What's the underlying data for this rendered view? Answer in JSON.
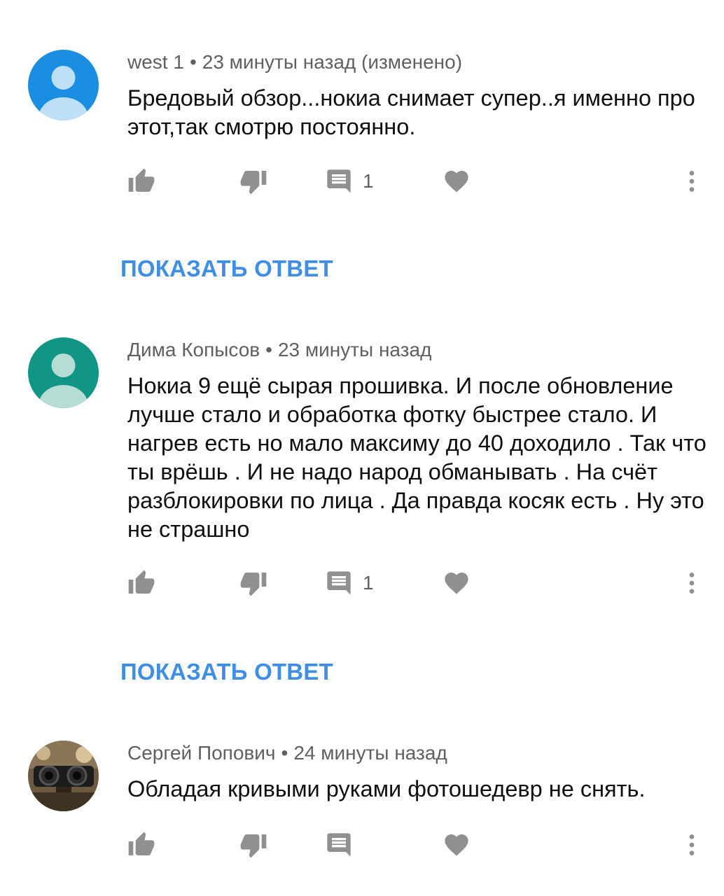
{
  "comments": [
    {
      "author": "west 1",
      "separator": "•",
      "time": "23 минуты назад (изменено)",
      "text": "Бредовый обзор...нокиа снимает супер..я именно про этот,так смотрю постоянно.",
      "reply_count": "1",
      "avatar_color": "#1a8ee1",
      "show_replies_label": "ПОКАЗАТЬ ОТВЕТ"
    },
    {
      "author": "Дима Копысов",
      "separator": "•",
      "time": "23 минуты назад",
      "text": "Нокиа 9 ещё сырая прошивка. И после обновление лучше стало и обработка фотку быстрее стало. И нагрев есть но мало максиму до 40 доходило .  Так что ты врёшь . И не надо народ обманывать . На счёт разблокировки по лица . Да правда косяк есть . Ну это не страшно",
      "reply_count": "1",
      "avatar_color": "#119585",
      "show_replies_label": "ПОКАЗАТЬ ОТВЕТ"
    },
    {
      "author": "Сергей Попович",
      "separator": "•",
      "time": "24 минуты назад",
      "text": "Обладая кривыми руками фотошедевр не снять.",
      "avatar_color": "#5b4a33"
    }
  ],
  "icons": {
    "like": "thumb-up-icon",
    "dislike": "thumb-down-icon",
    "reply": "comment-icon",
    "heart": "heart-icon",
    "more": "more-vert-icon"
  },
  "colors": {
    "icon_gray": "#909090",
    "link_blue": "#3e8ee6",
    "meta_gray": "#606060"
  }
}
